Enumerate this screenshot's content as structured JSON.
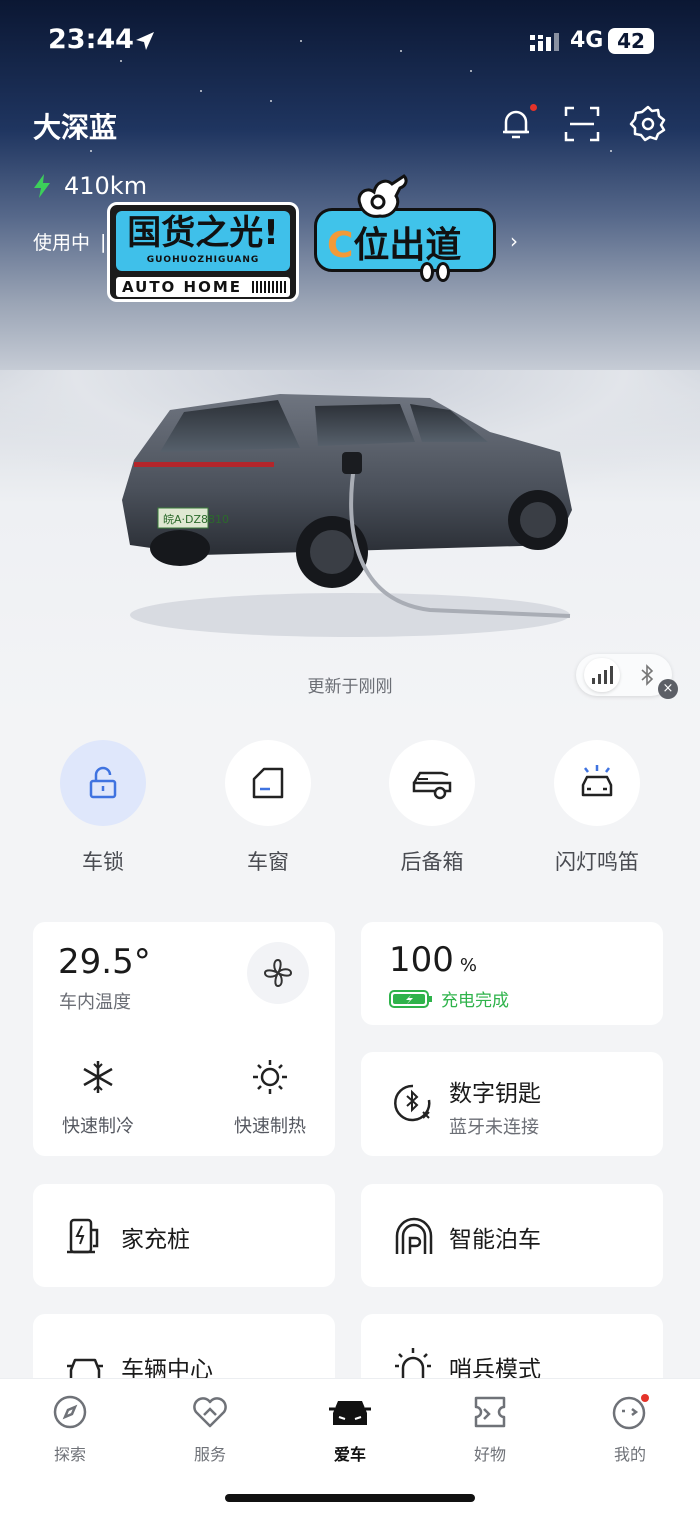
{
  "status_bar": {
    "time": "23:44",
    "network": "4G",
    "battery": "42"
  },
  "header": {
    "title": "大深蓝"
  },
  "range": {
    "value": "410km"
  },
  "usage": {
    "status": "使用中"
  },
  "stickers": {
    "left_main": "国货之光!",
    "left_sub": "GUOHUOZHIGUANG",
    "left_bottom": "AUTO HOME",
    "right_c": "C",
    "right_main": "位出道"
  },
  "car": {
    "plate": "皖A·DZ8810"
  },
  "updated_text": "更新于刚刚",
  "controls": [
    {
      "label": "车锁",
      "icon": "unlock-icon",
      "active": true
    },
    {
      "label": "车窗",
      "icon": "car-window-icon"
    },
    {
      "label": "后备箱",
      "icon": "trunk-icon"
    },
    {
      "label": "闪灯鸣笛",
      "icon": "flash-horn-icon"
    }
  ],
  "climate": {
    "temperature": "29.5°",
    "temperature_label": "车内温度",
    "cool_label": "快速制冷",
    "heat_label": "快速制热"
  },
  "battery_card": {
    "percent": "100",
    "unit": "%",
    "status": "充电完成"
  },
  "digital_key": {
    "title": "数字钥匙",
    "subtitle": "蓝牙未连接"
  },
  "home_charger": {
    "title": "家充桩"
  },
  "smart_parking": {
    "title": "智能泊车"
  },
  "vehicle_center": {
    "title": "车辆中心"
  },
  "sentry_mode": {
    "title": "哨兵模式"
  },
  "tabs": [
    {
      "label": "探索",
      "icon": "compass-icon"
    },
    {
      "label": "服务",
      "icon": "service-heart-icon"
    },
    {
      "label": "爱车",
      "icon": "car-icon",
      "active": true
    },
    {
      "label": "好物",
      "icon": "ticket-icon"
    },
    {
      "label": "我的",
      "icon": "profile-face-icon"
    }
  ],
  "colors": {
    "accent_green": "#2fb34b",
    "active_blue_bg": "#dfe7fb",
    "notification_red": "#e5332a"
  }
}
